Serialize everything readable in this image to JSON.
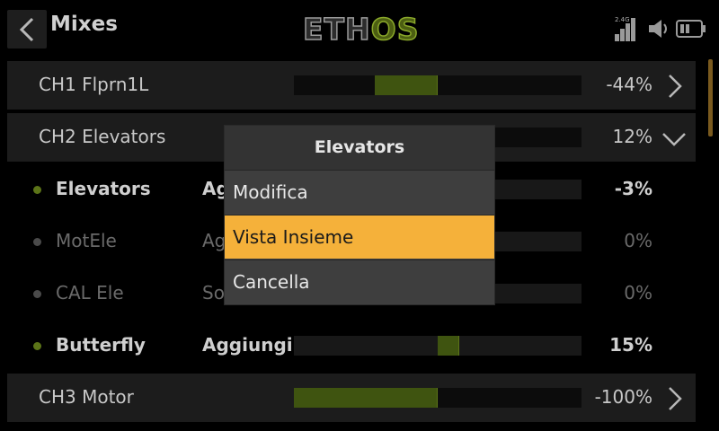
{
  "header": {
    "title": "Mixes",
    "logo_left": "ETH",
    "logo_right": "OS",
    "signal_band": "2.4G"
  },
  "rows": [
    {
      "kind": "channel",
      "name": "CH1 Flprn1L",
      "op": "",
      "value": "-44%",
      "fill": -0.44,
      "chevron": "right"
    },
    {
      "kind": "channel",
      "name": "CH2 Elevators",
      "op": "",
      "value": "12%",
      "fill": 0.12,
      "chevron": "down"
    },
    {
      "kind": "mix",
      "name": "Elevators",
      "op": "Aggiungi",
      "value": "-3%",
      "fill": -0.03,
      "state": "active"
    },
    {
      "kind": "mix",
      "name": "MotEle",
      "op": "Aggiungi",
      "value": "0%",
      "fill": 0,
      "state": "inactive"
    },
    {
      "kind": "mix",
      "name": "CAL Ele",
      "op": "Sostituisci",
      "value": "0%",
      "fill": 0,
      "state": "inactive"
    },
    {
      "kind": "mix",
      "name": "Butterfly",
      "op": "Aggiungi",
      "value": "15%",
      "fill": 0.15,
      "state": "active"
    },
    {
      "kind": "channel",
      "name": "CH3 Motor",
      "op": "",
      "value": "-100%",
      "fill": -1,
      "chevron": "right"
    }
  ],
  "dialog": {
    "title": "Elevators",
    "options": [
      "Modifica",
      "Vista Insieme",
      "Cancella"
    ],
    "selected_index": 1
  },
  "colors": {
    "accent": "#f5b13a",
    "bar_fill": "#3f5410",
    "active_dot": "#5c7418",
    "inactive_dot": "#4a4a4a"
  }
}
